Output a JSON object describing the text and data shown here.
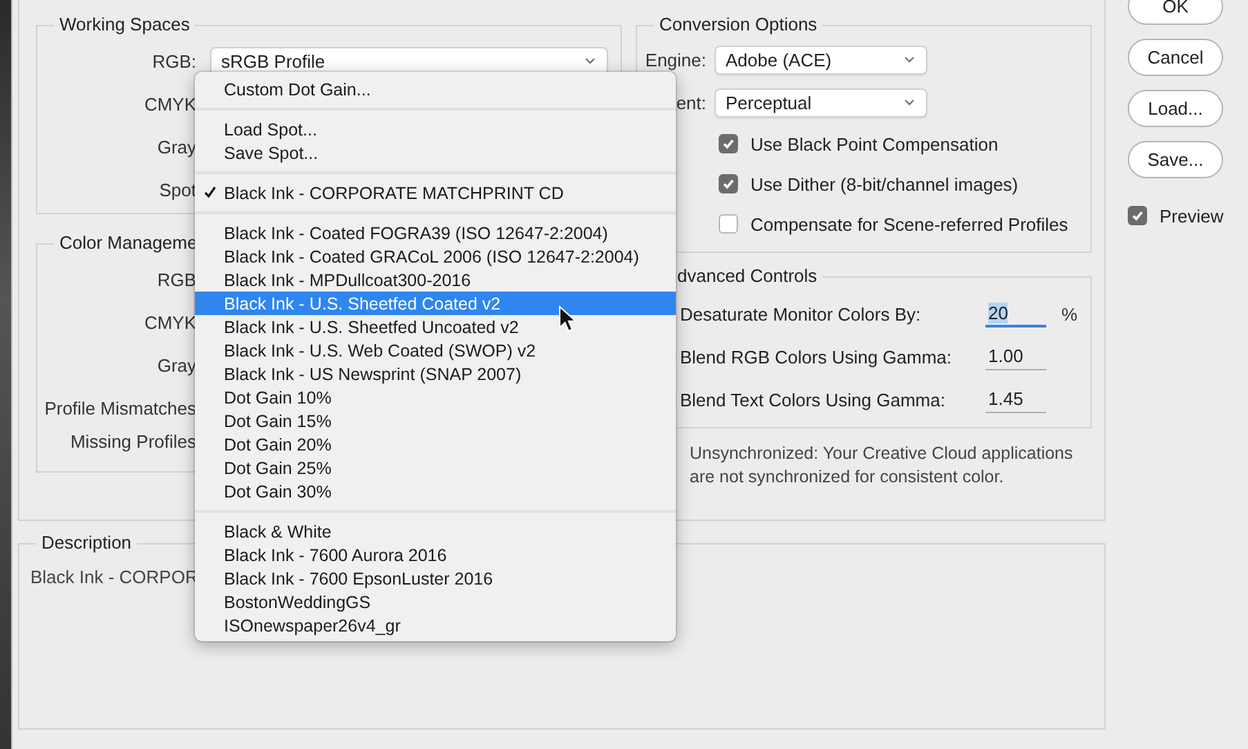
{
  "working_spaces": {
    "title": "Working Spaces",
    "rows": [
      {
        "label": "RGB:",
        "value": "sRGB Profile"
      },
      {
        "label": "CMYK"
      },
      {
        "label": "Gray"
      },
      {
        "label": "Spot"
      }
    ]
  },
  "color_management_policies": {
    "title": "Color Manageme",
    "rows": [
      {
        "label": "RGB"
      },
      {
        "label": "CMYK"
      },
      {
        "label": "Gray"
      },
      {
        "label": "Profile Mismatches"
      },
      {
        "label": "Missing Profiles"
      }
    ]
  },
  "conversion_options": {
    "title": "Conversion Options",
    "selects": [
      {
        "label": "Engine:",
        "value": "Adobe (ACE)"
      },
      {
        "label": "ent:",
        "value": "Perceptual"
      }
    ],
    "checkboxes": [
      {
        "label": "Use Black Point Compensation",
        "checked": true
      },
      {
        "label": "Use Dither (8-bit/channel images)",
        "checked": true
      },
      {
        "label": "Compensate for Scene-referred Profiles",
        "checked": false
      }
    ]
  },
  "advanced_controls": {
    "title": "dvanced Controls",
    "fields": [
      {
        "label": "Desaturate Monitor Colors By:",
        "value": "20",
        "unit": "%",
        "focused": true
      },
      {
        "label": "Blend RGB Colors Using Gamma:",
        "value": "1.00",
        "focused": false
      },
      {
        "label": "Blend Text Colors Using Gamma:",
        "value": "1.45",
        "focused": false
      }
    ]
  },
  "sync_message": "Unsynchronized: Your Creative Cloud applications are not synchronized for consistent color.",
  "description": {
    "title": "Description",
    "text": "Black Ink - CORPOR"
  },
  "buttons": [
    {
      "label": "OK"
    },
    {
      "label": "Cancel"
    },
    {
      "label": "Load..."
    },
    {
      "label": "Save..."
    }
  ],
  "preview": {
    "label": "Preview",
    "checked": true
  },
  "spot_menu": {
    "sections": [
      [
        {
          "label": "Custom Dot Gain...",
          "checked": false,
          "selected": false
        }
      ],
      [
        {
          "label": "Load Spot...",
          "checked": false,
          "selected": false
        },
        {
          "label": "Save Spot...",
          "checked": false,
          "selected": false
        }
      ],
      [
        {
          "label": "Black Ink - CORPORATE MATCHPRINT CD",
          "checked": true,
          "selected": false
        }
      ],
      [
        {
          "label": "Black Ink - Coated FOGRA39 (ISO 12647-2:2004)",
          "checked": false,
          "selected": false
        },
        {
          "label": "Black Ink - Coated GRACoL 2006 (ISO 12647-2:2004)",
          "checked": false,
          "selected": false
        },
        {
          "label": "Black Ink - MPDullcoat300-2016",
          "checked": false,
          "selected": false
        },
        {
          "label": "Black Ink - U.S. Sheetfed Coated v2",
          "checked": false,
          "selected": true
        },
        {
          "label": "Black Ink - U.S. Sheetfed Uncoated v2",
          "checked": false,
          "selected": false
        },
        {
          "label": "Black Ink - U.S. Web Coated (SWOP) v2",
          "checked": false,
          "selected": false
        },
        {
          "label": "Black Ink - US Newsprint (SNAP 2007)",
          "checked": false,
          "selected": false
        },
        {
          "label": "Dot Gain 10%",
          "checked": false,
          "selected": false
        },
        {
          "label": "Dot Gain 15%",
          "checked": false,
          "selected": false
        },
        {
          "label": "Dot Gain 20%",
          "checked": false,
          "selected": false
        },
        {
          "label": "Dot Gain 25%",
          "checked": false,
          "selected": false
        },
        {
          "label": "Dot Gain 30%",
          "checked": false,
          "selected": false
        }
      ],
      [
        {
          "label": "Black & White",
          "checked": false,
          "selected": false
        },
        {
          "label": "Black Ink - 7600 Aurora 2016",
          "checked": false,
          "selected": false
        },
        {
          "label": "Black Ink - 7600 EpsonLuster 2016",
          "checked": false,
          "selected": false
        },
        {
          "label": "BostonWeddingGS",
          "checked": false,
          "selected": false
        },
        {
          "label": "ISOnewspaper26v4_gr",
          "checked": false,
          "selected": false
        }
      ]
    ]
  }
}
